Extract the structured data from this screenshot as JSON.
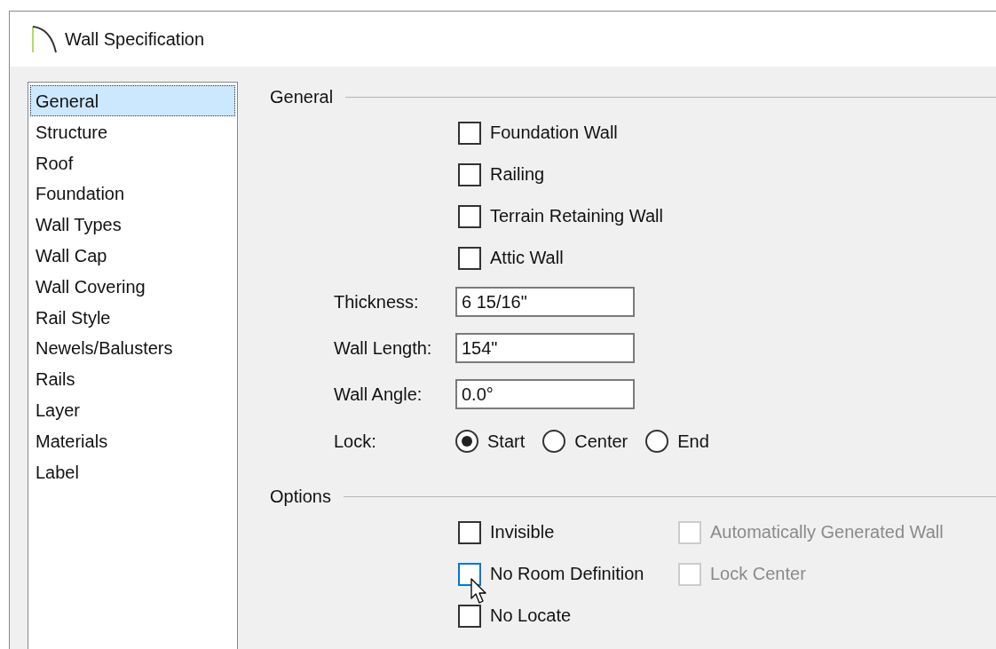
{
  "window": {
    "title": "Wall Specification"
  },
  "sidebar": {
    "items": [
      {
        "label": "General",
        "selected": true
      },
      {
        "label": "Structure",
        "selected": false
      },
      {
        "label": "Roof",
        "selected": false
      },
      {
        "label": "Foundation",
        "selected": false
      },
      {
        "label": "Wall Types",
        "selected": false
      },
      {
        "label": "Wall Cap",
        "selected": false
      },
      {
        "label": "Wall Covering",
        "selected": false
      },
      {
        "label": "Rail Style",
        "selected": false
      },
      {
        "label": "Newels/Balusters",
        "selected": false
      },
      {
        "label": "Rails",
        "selected": false
      },
      {
        "label": "Layer",
        "selected": false
      },
      {
        "label": "Materials",
        "selected": false
      },
      {
        "label": "Label",
        "selected": false
      }
    ]
  },
  "general": {
    "heading": "General",
    "items": [
      {
        "kind": "checkbox",
        "label": "Foundation Wall",
        "checked": false
      },
      {
        "kind": "checkbox",
        "label": "Railing",
        "checked": false
      },
      {
        "kind": "checkbox",
        "label": "Terrain Retaining Wall",
        "checked": false
      },
      {
        "kind": "checkbox",
        "label": "Attic Wall",
        "checked": false
      },
      {
        "kind": "field",
        "label": "Thickness:",
        "value": "6 15/16\""
      },
      {
        "kind": "field",
        "label": "Wall Length:",
        "value": "154\""
      },
      {
        "kind": "field",
        "label": "Wall Angle:",
        "value": "0.0°"
      },
      {
        "kind": "radios",
        "label": "Lock:",
        "options": [
          {
            "label": "Start",
            "selected": true
          },
          {
            "label": "Center",
            "selected": false
          },
          {
            "label": "End",
            "selected": false
          }
        ]
      }
    ]
  },
  "options": {
    "heading": "Options",
    "rows": [
      [
        {
          "label": "Invisible",
          "checked": false,
          "disabled": false,
          "hovered": false
        },
        {
          "label": "Automatically Generated Wall",
          "checked": false,
          "disabled": true,
          "hovered": false
        }
      ],
      [
        {
          "label": "No Room Definition",
          "checked": false,
          "disabled": false,
          "hovered": true
        },
        {
          "label": "Lock Center",
          "checked": false,
          "disabled": true,
          "hovered": false
        }
      ],
      [
        {
          "label": "No Locate",
          "checked": false,
          "disabled": false,
          "hovered": false
        }
      ]
    ]
  }
}
